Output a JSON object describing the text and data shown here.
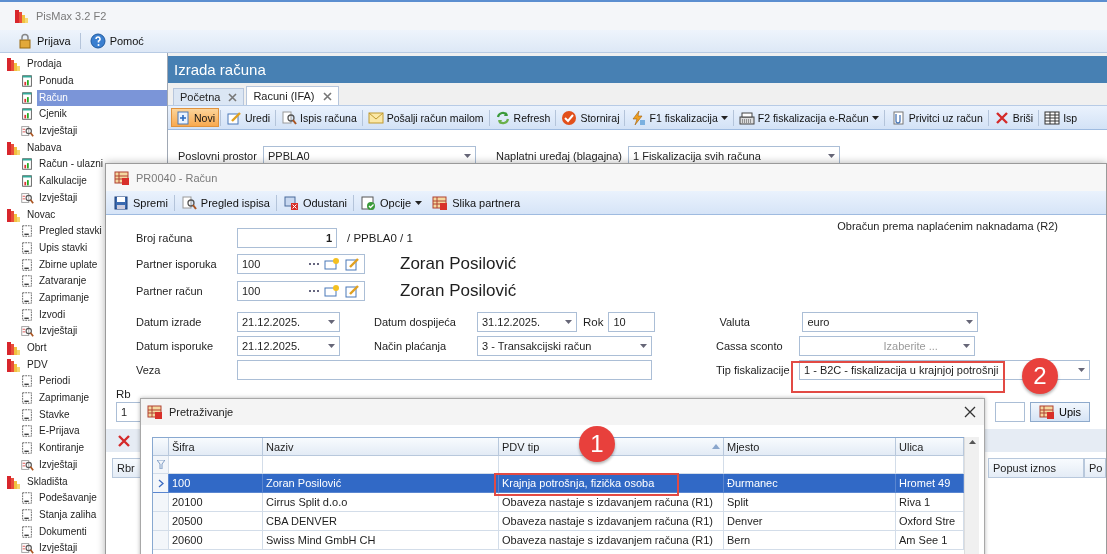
{
  "app": {
    "title": "PisMax 3.2 F2"
  },
  "menu": [
    {
      "label": "Prijava",
      "kind": "lock"
    },
    {
      "label": "Pomoć",
      "kind": "help"
    }
  ],
  "sidebar": {
    "groups": [
      {
        "label": "Prodaja",
        "children": [
          {
            "label": "Ponuda",
            "kind": "document",
            "selected": false
          },
          {
            "label": "Račun",
            "kind": "document",
            "selected": true
          },
          {
            "label": "Cjenik",
            "kind": "document",
            "selected": false
          },
          {
            "label": "Izvještaji",
            "kind": "report",
            "selected": false
          }
        ]
      },
      {
        "label": "Nabava",
        "children": [
          {
            "label": "Račun - ulazni",
            "kind": "document",
            "selected": false
          },
          {
            "label": "Kalkulacije",
            "kind": "document",
            "selected": false
          },
          {
            "label": "Izvještaji",
            "kind": "report",
            "selected": false
          }
        ]
      },
      {
        "label": "Novac",
        "children": [
          {
            "label": "Pregled stavki",
            "kind": "page",
            "selected": false
          },
          {
            "label": "Upis stavki",
            "kind": "page",
            "selected": false
          },
          {
            "label": "Zbirne uplate",
            "kind": "page",
            "selected": false
          },
          {
            "label": "Zatvaranje",
            "kind": "page",
            "selected": false
          },
          {
            "label": "Zaprimanje",
            "kind": "page",
            "selected": false
          },
          {
            "label": "Izvodi",
            "kind": "page",
            "selected": false
          },
          {
            "label": "Izvještaji",
            "kind": "report",
            "selected": false
          }
        ]
      },
      {
        "label": "Obrt"
      },
      {
        "label": "PDV",
        "children": [
          {
            "label": "Periodi",
            "kind": "page",
            "selected": false
          },
          {
            "label": "Zaprimanje",
            "kind": "page",
            "selected": false
          },
          {
            "label": "Stavke",
            "kind": "page",
            "selected": false
          },
          {
            "label": "E-Prijava",
            "kind": "page",
            "selected": false
          },
          {
            "label": "Kontiranje",
            "kind": "page",
            "selected": false
          },
          {
            "label": "Izvještaji",
            "kind": "report",
            "selected": false
          }
        ]
      },
      {
        "label": "Skladišta",
        "children": [
          {
            "label": "Podešavanje",
            "kind": "page",
            "selected": false
          },
          {
            "label": "Stanja zaliha",
            "kind": "page",
            "selected": false
          },
          {
            "label": "Dokumenti",
            "kind": "page",
            "selected": false
          },
          {
            "label": "Izvještaji",
            "kind": "report",
            "selected": false
          }
        ]
      }
    ]
  },
  "main": {
    "title": "Izrada računa",
    "tabs": [
      {
        "label": "Početna",
        "selected": false
      },
      {
        "label": "Racuni (IFA)",
        "selected": true
      }
    ],
    "toolbar": [
      {
        "label": "Novi",
        "kind": "new",
        "active": true,
        "dropdown": false
      },
      {
        "label": "Uredi",
        "kind": "edit",
        "active": false,
        "dropdown": false
      },
      {
        "label": "Ispis računa",
        "kind": "print",
        "active": false,
        "dropdown": false
      },
      {
        "label": "Pošalji račun mailom",
        "kind": "mail",
        "active": false,
        "dropdown": false
      },
      {
        "label": "Refresh",
        "kind": "refresh",
        "active": false,
        "dropdown": false
      },
      {
        "label": "Storniraj",
        "kind": "check",
        "active": false,
        "dropdown": false
      },
      {
        "label": "F1 fiskalizacija",
        "kind": "lightning",
        "active": false,
        "dropdown": true
      },
      {
        "label": "F2 fiskalizacija e-Račun",
        "kind": "register",
        "active": false,
        "dropdown": true
      },
      {
        "label": "Privitci uz račun",
        "kind": "attach",
        "active": false,
        "dropdown": false
      },
      {
        "label": "Briši",
        "kind": "delete",
        "active": false,
        "dropdown": false
      },
      {
        "label": "Isp",
        "kind": "table",
        "active": false,
        "dropdown": false
      }
    ],
    "filters": [
      {
        "label": "Poslovni prostor",
        "value": "PPBLA0"
      },
      {
        "label": "Naplatni uređaj (blagajna)",
        "value": "1 Fiskalizacija svih računa"
      }
    ]
  },
  "invoice_dialog": {
    "title": "PR0040 - Račun",
    "toolbar": [
      {
        "label": "Spremi",
        "kind": "save",
        "dropdown": false
      },
      {
        "label": "Pregled ispisa",
        "kind": "print",
        "dropdown": false
      },
      {
        "label": "Odustani",
        "kind": "cancel",
        "dropdown": false
      },
      {
        "label": "Opcije",
        "kind": "options",
        "dropdown": true
      },
      {
        "label": "Slika partnera",
        "kind": "picture",
        "dropdown": false
      }
    ],
    "number": {
      "label": "Broj računa",
      "value": "1",
      "suffix": "/ PPBLA0 / 1"
    },
    "note": "Obračun prema naplaćenim naknadama (R2)",
    "partners": [
      {
        "label": "Partner isporuka",
        "value": "100",
        "name": "Zoran Posilović"
      },
      {
        "label": "Partner račun",
        "value": "100",
        "name": "Zoran Posilović"
      }
    ],
    "created": {
      "label": "Datum izrade",
      "value": "21.12.2025."
    },
    "due": {
      "label": "Datum dospijeća",
      "value": "31.12.2025."
    },
    "term": {
      "label": "Rok",
      "value": "10"
    },
    "currency": {
      "label": "Valuta",
      "value": "euro"
    },
    "delivered": {
      "label": "Datum isporuke",
      "value": "21.12.2025."
    },
    "payment": {
      "label": "Način plaćanja",
      "value": "3 - Transakcijski račun"
    },
    "discount": {
      "label": "Cassa sconto",
      "placeholder": "Izaberite ..."
    },
    "link": {
      "label": "Veza"
    },
    "fiscal_type": {
      "label": "Tip fiskalizacije",
      "value": "1 - B2C - fiskalizacija u krajnjoj potrošnji"
    },
    "items": {
      "rb_label": "Rb",
      "rb_value": "1",
      "add_button": "Upis",
      "columns": [
        "Rbr",
        "Popust iznos",
        "Po"
      ]
    }
  },
  "search_dialog": {
    "title": "Pretraživanje",
    "columns": [
      {
        "label": "Šifra",
        "sorted": false
      },
      {
        "label": "Naziv",
        "sorted": false
      },
      {
        "label": "PDV tip",
        "sorted": true
      },
      {
        "label": "Mjesto",
        "sorted": false
      },
      {
        "label": "Ulica",
        "sorted": false
      }
    ],
    "rows": [
      {
        "cells": [
          "100",
          "Zoran Posilović",
          "Krajnja potrošnja, fizička osoba",
          "Đurmanec",
          "Hromet 49"
        ],
        "selected": true
      },
      {
        "cells": [
          "20100",
          "Cirrus Split d.o.o",
          "Obaveza nastaje s izdavanjem računa (R1)",
          "Split",
          "Riva 1"
        ],
        "selected": false
      },
      {
        "cells": [
          "20500",
          "CBA DENVER",
          "Obaveza nastaje s izdavanjem računa (R1)",
          "Denver",
          "Oxford Stre"
        ],
        "selected": false
      },
      {
        "cells": [
          "20600",
          "Swiss Mind GmbH CH",
          "Obaveza nastaje s izdavanjem računa (R1)",
          "Bern",
          "Am See 1"
        ],
        "selected": false
      }
    ]
  },
  "callouts": [
    {
      "label": "1"
    },
    {
      "label": "2"
    }
  ]
}
